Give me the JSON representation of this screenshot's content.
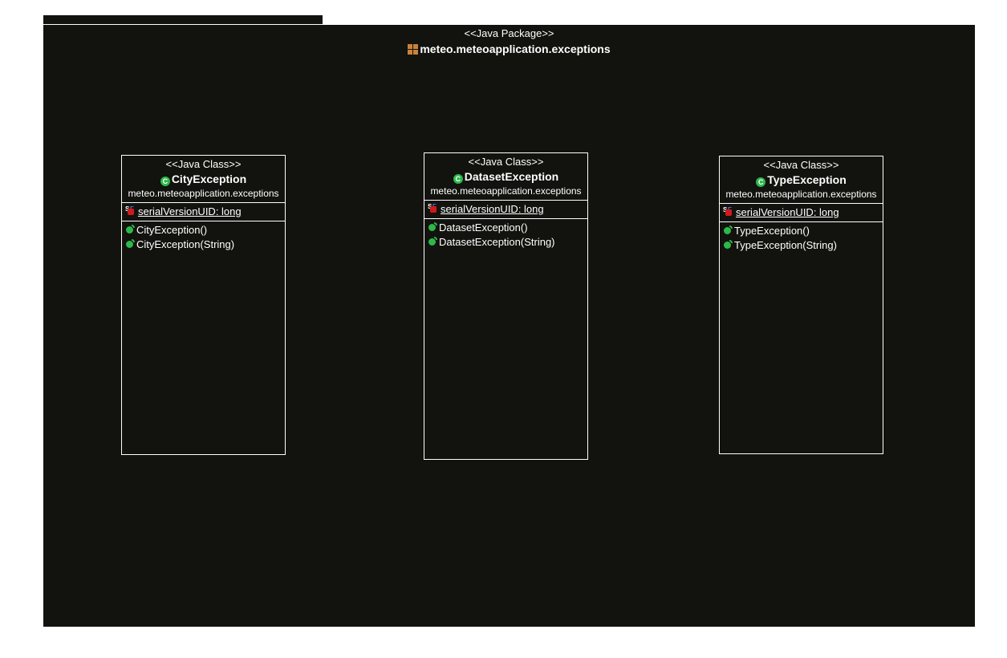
{
  "package": {
    "stereotype": "<<Java Package>>",
    "name": "meteo.meteoapplication.exceptions"
  },
  "classes": [
    {
      "stereotype": "<<Java Class>>",
      "name": "CityException",
      "package": "meteo.meteoapplication.exceptions",
      "fields": [
        "serialVersionUID: long"
      ],
      "methods": [
        "CityException()",
        "CityException(String)"
      ]
    },
    {
      "stereotype": "<<Java Class>>",
      "name": "DatasetException",
      "package": "meteo.meteoapplication.exceptions",
      "fields": [
        "serialVersionUID: long"
      ],
      "methods": [
        "DatasetException()",
        "DatasetException(String)"
      ]
    },
    {
      "stereotype": "<<Java Class>>",
      "name": "TypeException",
      "package": "meteo.meteoapplication.exceptions",
      "fields": [
        "serialVersionUID: long"
      ],
      "methods": [
        "TypeException()",
        "TypeException(String)"
      ]
    }
  ],
  "colors": {
    "background": "#12120f",
    "border": "#ffffff",
    "class_icon": "#2db84a",
    "static_final_icon": "#d11a1a",
    "package_icon": "#c9823a"
  },
  "icons": {
    "package": "package-icon",
    "class": "class-icon",
    "field": "static-final-field-icon",
    "method": "public-method-icon"
  }
}
